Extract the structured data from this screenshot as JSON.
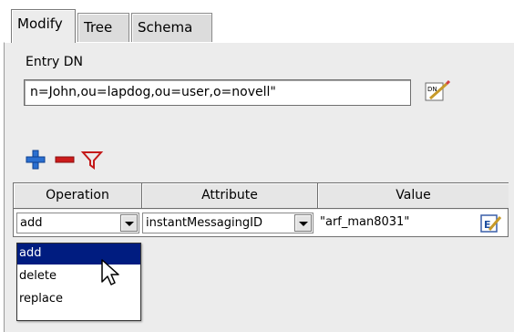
{
  "tabs": [
    {
      "label": "Modify",
      "active": true
    },
    {
      "label": "Tree",
      "active": false
    },
    {
      "label": "Schema",
      "active": false
    }
  ],
  "entry": {
    "label": "Entry DN",
    "value": "n=John,ou=lapdog,ou=user,o=novell\""
  },
  "toolbar": {
    "add_icon": "plus-icon",
    "remove_icon": "minus-icon",
    "filter_icon": "filter-icon"
  },
  "table": {
    "headers": [
      "Operation",
      "Attribute",
      "Value"
    ],
    "row": {
      "operation": "add",
      "attribute": "instantMessagingID",
      "value": "\"arf_man8031\""
    }
  },
  "dropdown": {
    "options": [
      "add",
      "delete",
      "replace"
    ],
    "selected": "add"
  },
  "colors": {
    "selection": "#001c80",
    "add_icon": "#2a6fd0",
    "remove_icon": "#cc1b1b",
    "filter_icon": "#c41a1a"
  }
}
